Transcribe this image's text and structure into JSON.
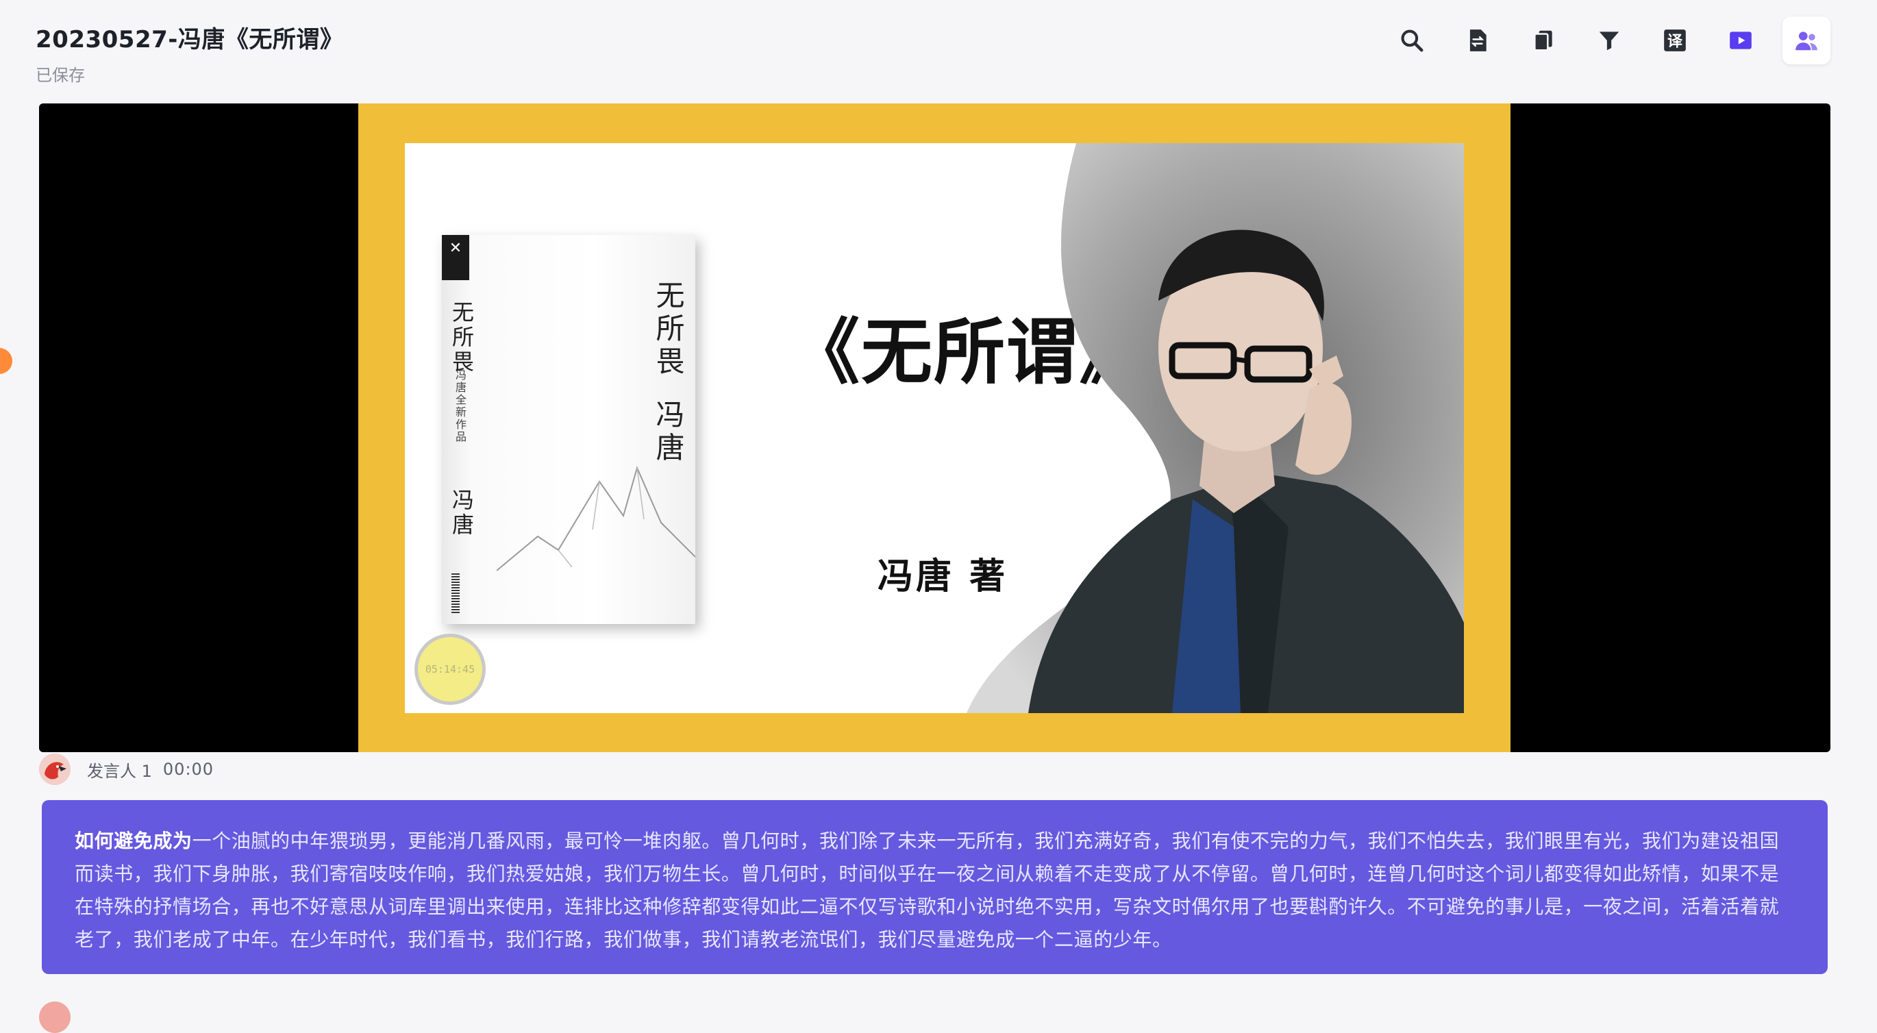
{
  "header": {
    "title": "20230527-冯唐《无所谓》",
    "status": "已保存"
  },
  "toolbar": [
    {
      "icon": "search-icon",
      "name": "search-button"
    },
    {
      "icon": "swap-doc-icon",
      "name": "convert-doc-button"
    },
    {
      "icon": "copy-icon",
      "name": "copy-button"
    },
    {
      "icon": "filter-icon",
      "name": "filter-button"
    },
    {
      "icon": "translate-icon",
      "name": "translate-button",
      "label": "译"
    },
    {
      "icon": "video-icon",
      "name": "video-button"
    },
    {
      "icon": "speakers-icon",
      "name": "speakers-button",
      "active": true
    }
  ],
  "slide": {
    "title": "《无所谓》",
    "author": "冯唐 著",
    "book": {
      "title": "无所畏",
      "author": "冯唐",
      "subtitle": "冯唐全新作品"
    },
    "timer": "05:14:45"
  },
  "speaker": {
    "name": "发言人 1",
    "time": "00:00"
  },
  "transcript": {
    "highlight": "如何避免成为",
    "text": "一个油腻的中年猥琐男，更能消几番风雨，最可怜一堆肉躯。曾几何时，我们除了未来一无所有，我们充满好奇，我们有使不完的力气，我们不怕失去，我们眼里有光，我们为建设祖国而读书，我们下身肿胀，我们寄宿吱吱作响，我们热爱姑娘，我们万物生长。曾几何时，时间似乎在一夜之间从赖着不走变成了从不停留。曾几何时，连曾几何时这个词儿都变得如此矫情，如果不是在特殊的抒情场合，再也不好意思从词库里调出来使用，连排比这种修辞都变得如此二逼不仅写诗歌和小说时绝不实用，写杂文时偶尔用了也要斟酌许久。不可避免的事儿是，一夜之间，活着活着就老了，我们老成了中年。在少年时代，我们看书，我们行路，我们做事，我们请教老流氓们，我们尽量避免成一个二逼的少年。"
  },
  "colors": {
    "accent": "#6559df",
    "frame": "#f0be38",
    "active_icon": "#7a5cf0"
  }
}
